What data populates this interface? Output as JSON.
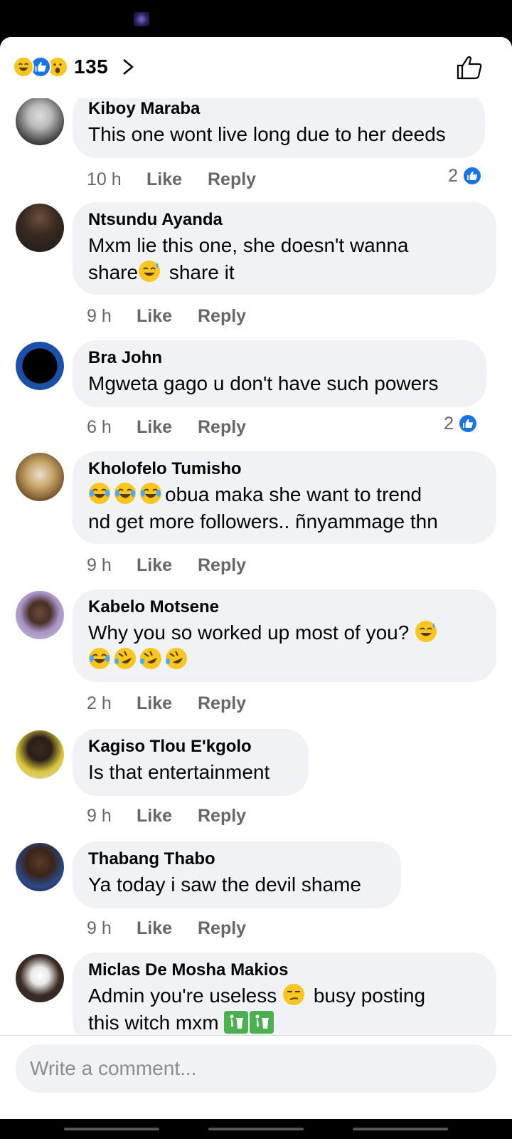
{
  "header": {
    "reaction_count": "135"
  },
  "comments": [
    {
      "author": "Kiboy Maraba",
      "text": "This one wont live long due to her deeds",
      "time": "10 h",
      "like_count": "2"
    },
    {
      "author": "Ntsundu Ayanda",
      "text_1": "Mxm lie this one, she doesn't wanna",
      "text_2a": "share",
      "text_2b": " share it",
      "time": "9 h"
    },
    {
      "author": "Bra John",
      "text": "Mgweta gago u don't have such powers",
      "time": "6 h",
      "like_count": "2"
    },
    {
      "author": "Kholofelo Tumisho",
      "text_1": "obua maka she want to  trend",
      "text_2": "nd get more followers.. ñnyammage thn",
      "time": "9 h"
    },
    {
      "author": "Kabelo Motsene",
      "text": "Why you so worked up most of you?",
      "time": "2 h"
    },
    {
      "author": "Kagiso Tlou E'kgolo",
      "text": "Is that entertainment",
      "time": "9 h"
    },
    {
      "author": "Thabang Thabo",
      "text": "Ya today i saw the devil shame",
      "time": "9 h"
    },
    {
      "author": "Miclas De Mosha Makios",
      "text_1a": "Admin you're useless",
      "text_1b": "busy posting",
      "text_2": "this witch mxm"
    }
  ],
  "actions": {
    "like": "Like",
    "reply": "Reply"
  },
  "composer": {
    "placeholder": "Write a comment..."
  },
  "icons": [
    "haha-reaction-icon",
    "like-reaction-icon",
    "wow-reaction-icon",
    "chevron-right-icon",
    "thumbs-up-icon",
    "sweat-smile-emoji-icon",
    "joy-emoji-icon",
    "rofl-emoji-icon",
    "unamused-emoji-icon",
    "litter-bin-emoji-icon"
  ],
  "colors": {
    "accent": "#1b74e4",
    "bubble": "#f0f2f5",
    "meta_text": "#65676b"
  }
}
